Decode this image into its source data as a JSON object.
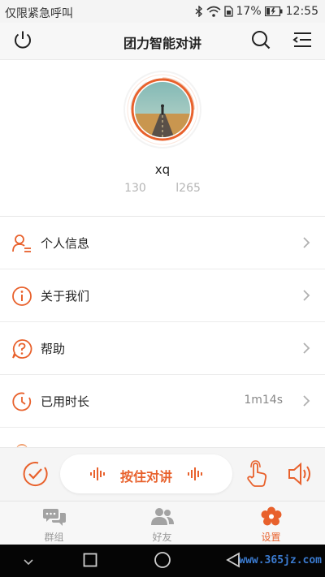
{
  "status_bar": {
    "left_text": "仅限紧急呼叫",
    "battery_percent": "17%",
    "time": "12:55"
  },
  "header": {
    "title": "团力智能对讲"
  },
  "profile": {
    "name": "xq",
    "id_left": "130",
    "id_right": "l265"
  },
  "menu": {
    "items": [
      {
        "label": "个人信息",
        "value": "",
        "icon": "user-list-icon"
      },
      {
        "label": "关于我们",
        "value": "",
        "icon": "info-icon"
      },
      {
        "label": "帮助",
        "value": "",
        "icon": "help-icon"
      },
      {
        "label": "已用时长",
        "value": "1m14s",
        "icon": "clock-icon"
      }
    ]
  },
  "ptt": {
    "label": "按住对讲"
  },
  "tabs": [
    {
      "label": "群组",
      "icon": "chat-icon",
      "active": false
    },
    {
      "label": "好友",
      "icon": "friends-icon",
      "active": false
    },
    {
      "label": "设置",
      "icon": "settings-flower-icon",
      "active": true
    }
  ],
  "watermark": "www.365jz.com",
  "colors": {
    "accent": "#e8612c",
    "inactive": "#9a9a9a",
    "background": "#ffffff"
  }
}
